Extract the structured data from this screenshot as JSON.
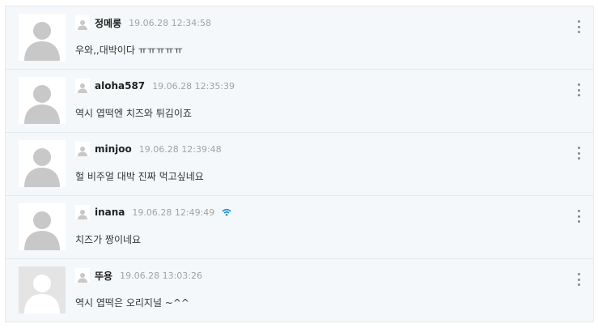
{
  "comments": [
    {
      "nickname": "정메롱",
      "date": "19.06.28 12:34:58",
      "text": "우와,,대박이다 ㅠㅠㅠㅠㅠ",
      "avatar": "default"
    },
    {
      "nickname": "aloha587",
      "date": "19.06.28 12:35:39",
      "text": "역시 엽떡엔 치즈와 튀김이죠",
      "avatar": "default"
    },
    {
      "nickname": "minjoo",
      "date": "19.06.28 12:39:48",
      "text": "헐 비주얼 대박 진짜 먹고싶네요",
      "avatar": "default"
    },
    {
      "nickname": "inana",
      "date": "19.06.28 12:49:49",
      "text": "치즈가 짱이네요",
      "avatar": "default",
      "badge": "wifi-icon"
    },
    {
      "nickname": "뚜용",
      "date": "19.06.28 13:03:26",
      "text": "역시 엽떡은 오리지널 ~^^",
      "avatar": "photo-placeholder"
    }
  ],
  "colors": {
    "silhouette": "#c8c8c8",
    "badge": "#1e8fd6",
    "panel": "#f5f8fa"
  }
}
